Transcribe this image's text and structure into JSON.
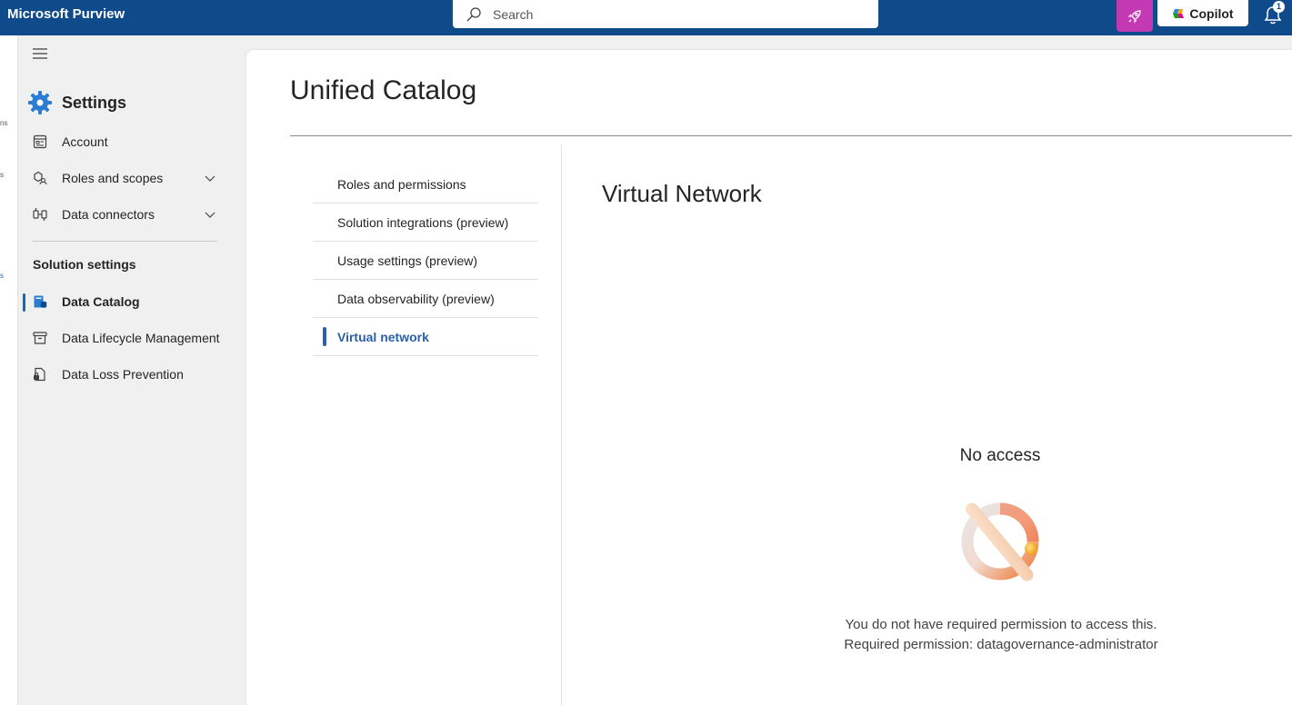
{
  "app": {
    "title": "Microsoft Purview"
  },
  "search": {
    "placeholder": "Search"
  },
  "topbar": {
    "copilot_label": "Copilot",
    "notification_count": "1"
  },
  "rail": {
    "fragments": [
      "ns",
      "s",
      "s"
    ]
  },
  "sidebar": {
    "title": "Settings",
    "items": [
      {
        "label": "Account",
        "icon": "account-icon"
      },
      {
        "label": "Roles and scopes",
        "icon": "roles-icon"
      },
      {
        "label": "Data connectors",
        "icon": "connectors-icon"
      }
    ],
    "section_label": "Solution settings",
    "solution_items": [
      {
        "label": "Data Catalog",
        "icon": "data-catalog-icon",
        "active": true
      },
      {
        "label": "Data Lifecycle Management",
        "icon": "lifecycle-icon"
      },
      {
        "label": "Data Loss Prevention",
        "icon": "dlp-icon"
      }
    ]
  },
  "main": {
    "title": "Unified Catalog",
    "sub_nav": [
      {
        "label": "Roles and permissions"
      },
      {
        "label": "Solution integrations (preview)"
      },
      {
        "label": "Usage settings (preview)"
      },
      {
        "label": "Data observability (preview)"
      },
      {
        "label": "Virtual network",
        "active": true
      }
    ],
    "section_title": "Virtual Network",
    "no_access": {
      "title": "No access",
      "message_line1": "You do not have required permission to access this.",
      "message_line2": "Required permission: datagovernance-administrator"
    }
  },
  "colors": {
    "topbar": "#0f4a8a",
    "accent": "#2a61a8",
    "rocket": "#c239b3"
  }
}
